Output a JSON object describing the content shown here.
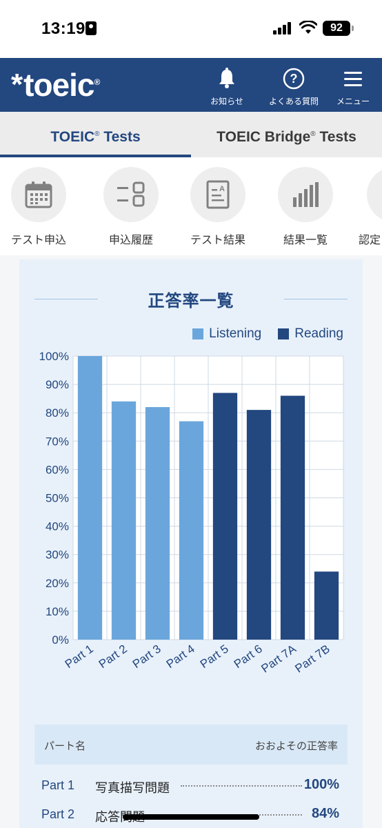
{
  "status_bar": {
    "time": "13:19",
    "battery": "92"
  },
  "header": {
    "logo_text": "toeic",
    "logo_reg": "®",
    "notifications_label": "お知らせ",
    "faq_label": "よくある質問",
    "menu_label": "メニュー"
  },
  "tabs": [
    {
      "label": "TOEIC",
      "suffix": "Tests",
      "reg": "®",
      "active": true
    },
    {
      "label": "TOEIC Bridge",
      "suffix": "Tests",
      "reg": "®",
      "active": false
    }
  ],
  "shortcuts": [
    {
      "label": "テスト申込",
      "icon": "calendar-icon"
    },
    {
      "label": "申込履歴",
      "icon": "history-list-icon"
    },
    {
      "label": "テスト結果",
      "icon": "test-result-document-icon"
    },
    {
      "label": "結果一覧",
      "icon": "bar-chart-icon"
    },
    {
      "label": "認定",
      "icon": "certificate-icon"
    }
  ],
  "colors": {
    "brand": "#23477f",
    "listening": "#6aa6dc",
    "reading": "#23477f",
    "card_bg": "#e8f1fa"
  },
  "chart_data": {
    "type": "bar",
    "title": "正答率一覧",
    "categories": [
      "Part 1",
      "Part 2",
      "Part 3",
      "Part 4",
      "Part 5",
      "Part 6",
      "Part 7A",
      "Part 7B"
    ],
    "series": [
      {
        "name": "Listening",
        "values": [
          100,
          84,
          82,
          77,
          null,
          null,
          null,
          null
        ]
      },
      {
        "name": "Reading",
        "values": [
          null,
          null,
          null,
          null,
          87,
          81,
          86,
          24
        ]
      }
    ],
    "yticks": [
      "100%",
      "90%",
      "80%",
      "70%",
      "60%",
      "50%",
      "40%",
      "30%",
      "20%",
      "10%",
      "0%"
    ],
    "ylim": [
      0,
      100
    ],
    "grid": true,
    "legend": "top-right"
  },
  "table": {
    "header_left": "パート名",
    "header_right": "おおよその正答率",
    "rows": [
      {
        "part": "Part 1",
        "desc": "写真描写問題",
        "value": "100%"
      },
      {
        "part": "Part 2",
        "desc": "応答問題",
        "value": "84%"
      }
    ]
  }
}
